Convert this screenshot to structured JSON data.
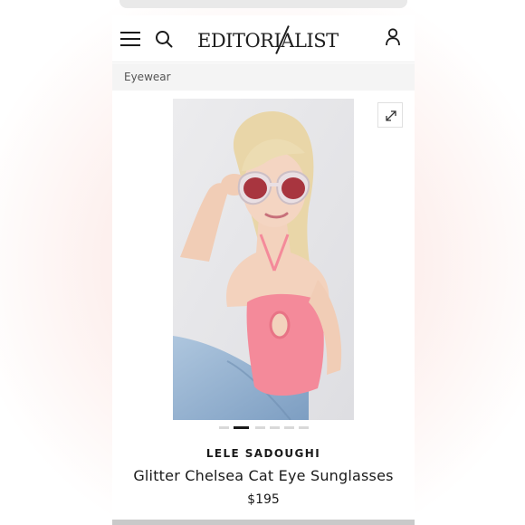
{
  "header": {
    "logo_text": "EDITORIALIST",
    "icons": {
      "menu": "hamburger-menu-icon",
      "search": "search-icon",
      "account": "user-account-icon"
    }
  },
  "breadcrumb": {
    "label": "Eyewear"
  },
  "product": {
    "brand": "LELE SADOUGHI",
    "name": "Glitter Chelsea Cat Eye Sunglasses",
    "price": "$195",
    "image_count": 6,
    "active_image_index": 1
  },
  "colors": {
    "text": "#1a1a1a",
    "breadcrumb_bg": "#f4f4f4",
    "top_pink": "#f48a9a",
    "lens": "#a8353f"
  }
}
